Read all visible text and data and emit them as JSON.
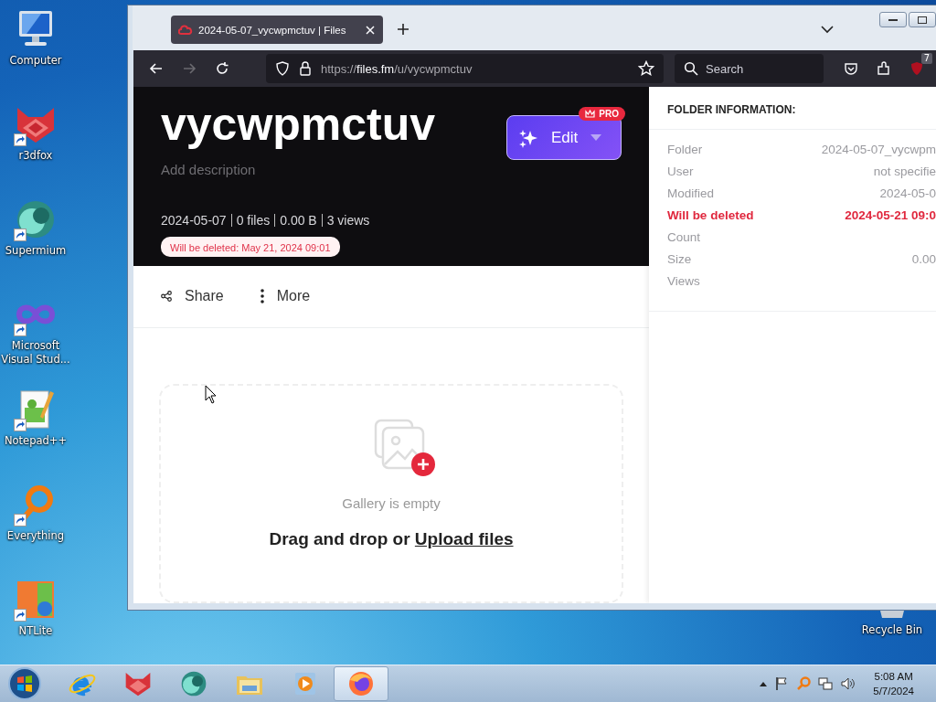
{
  "desktop": {
    "icons": [
      {
        "label": "Computer",
        "kind": "computer",
        "shortcut": false
      },
      {
        "label": "r3dfox",
        "kind": "fox",
        "shortcut": true
      },
      {
        "label": "Supermium",
        "kind": "supermium",
        "shortcut": true
      },
      {
        "label": "Microsoft Visual Stud...",
        "kind": "vs",
        "shortcut": true
      },
      {
        "label": "Notepad++",
        "kind": "notepad",
        "shortcut": true
      },
      {
        "label": "Everything",
        "kind": "everything",
        "shortcut": true
      },
      {
        "label": "NTLite",
        "kind": "ntlite",
        "shortcut": true
      }
    ],
    "recycle_bin": {
      "label": "Recycle Bin"
    }
  },
  "browser": {
    "tab": {
      "title": "2024-05-07_vycwpmctuv | Files"
    },
    "url": {
      "scheme": "https://",
      "host": "files.fm",
      "path": "/u/vycwpmctuv"
    },
    "search": {
      "placeholder": "Search"
    },
    "extension_badge": "7"
  },
  "header": {
    "title": "vycwpmctuv",
    "edit_button": "Edit",
    "pro_badge": "PRO",
    "description": {
      "placeholder": "Add description"
    },
    "meta": [
      "2024-05-07",
      "0 files",
      "0.00  B",
      "3 views"
    ],
    "deletion_notice": "Will be deleted: May 21, 2024 09:01"
  },
  "actions": [
    {
      "label": "Share",
      "kind": "share"
    },
    {
      "label": "More",
      "kind": "more"
    }
  ],
  "gallery": {
    "empty_text": "Gallery is empty",
    "drop_text": "Drag and drop or",
    "upload_link": "Upload files"
  },
  "folder_info": {
    "title": "FOLDER INFORMATION:",
    "rows": [
      {
        "label": "Folder",
        "value": "2024-05-07_vycwpm",
        "highlight": false
      },
      {
        "label": "User",
        "value": "not specifie",
        "highlight": false
      },
      {
        "label": "Modified",
        "value": "2024-05-0",
        "highlight": false
      },
      {
        "label": "Will be deleted",
        "value": "2024-05-21 09:0",
        "highlight": true
      },
      {
        "label": "Count",
        "highlight": false
      },
      {
        "label": "Size",
        "value": "0.00",
        "highlight": false
      },
      {
        "label": "Views",
        "highlight": false
      }
    ]
  },
  "taskbar": {
    "pinned": [
      {
        "kind": "ie",
        "active": false
      },
      {
        "kind": "fox",
        "active": false
      },
      {
        "kind": "supermium",
        "active": false
      },
      {
        "kind": "explorer",
        "active": false
      },
      {
        "kind": "media",
        "active": false
      },
      {
        "kind": "firefox",
        "active": true
      }
    ],
    "clock": {
      "time": "5:08 AM",
      "date": "5/7/2024"
    }
  }
}
